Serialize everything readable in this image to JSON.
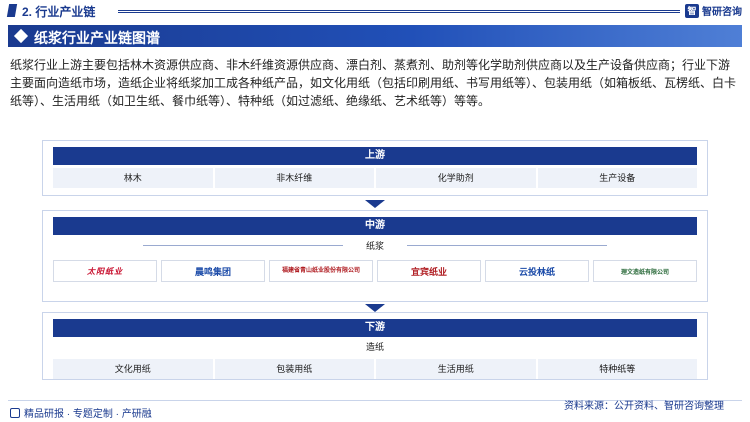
{
  "header": {
    "section_title": "2. 行业产业链",
    "brand": "智研咨询",
    "brand_mark": "智"
  },
  "banner": {
    "title": "纸浆行业产业链图谱"
  },
  "description": "纸浆行业上游主要包括林木资源供应商、非木纤维资源供应商、漂白剂、蒸煮剂、助剂等化学助剂供应商以及生产设备供应商；行业下游主要面向造纸市场，造纸企业将纸浆加工成各种纸产品，如文化用纸（包括印刷用纸、书写用纸等）、包装用纸（如箱板纸、瓦楞纸、白卡纸等）、生活用纸（如卫生纸、餐巾纸等）、特种纸（如过滤纸、绝缘纸、艺术纸等）等等。",
  "upstream": {
    "title": "上游",
    "items": [
      "林木",
      "非木纤维",
      "化学助剂",
      "生产设备"
    ]
  },
  "midstream": {
    "title": "中游",
    "label": "纸浆",
    "companies": [
      {
        "name": "太阳纸业",
        "icon": "sun-paper-logo"
      },
      {
        "name": "晨鸣集团",
        "sub": "CHENMING GROUP"
      },
      {
        "name": "福建省青山纸业股份有限公司",
        "sub": "Fujian Qingshan Paper Industry Co.,Ltd"
      },
      {
        "name": "宜宾纸业"
      },
      {
        "name": "云投林纸"
      },
      {
        "name": "理文造纸有限公司",
        "sub": "Lee & Man Paper Manufacturing Limited"
      }
    ]
  },
  "downstream": {
    "title": "下游",
    "label": "造纸",
    "items": [
      "文化用纸",
      "包装用纸",
      "生活用纸",
      "特种纸等"
    ]
  },
  "footer": {
    "left": "精品研报 · 专题定制 · 产研融",
    "right": "资料来源：公开资料、智研咨询整理"
  },
  "colors": {
    "primary": "#1a3a8f",
    "cell_bg": "#eef2f9"
  }
}
